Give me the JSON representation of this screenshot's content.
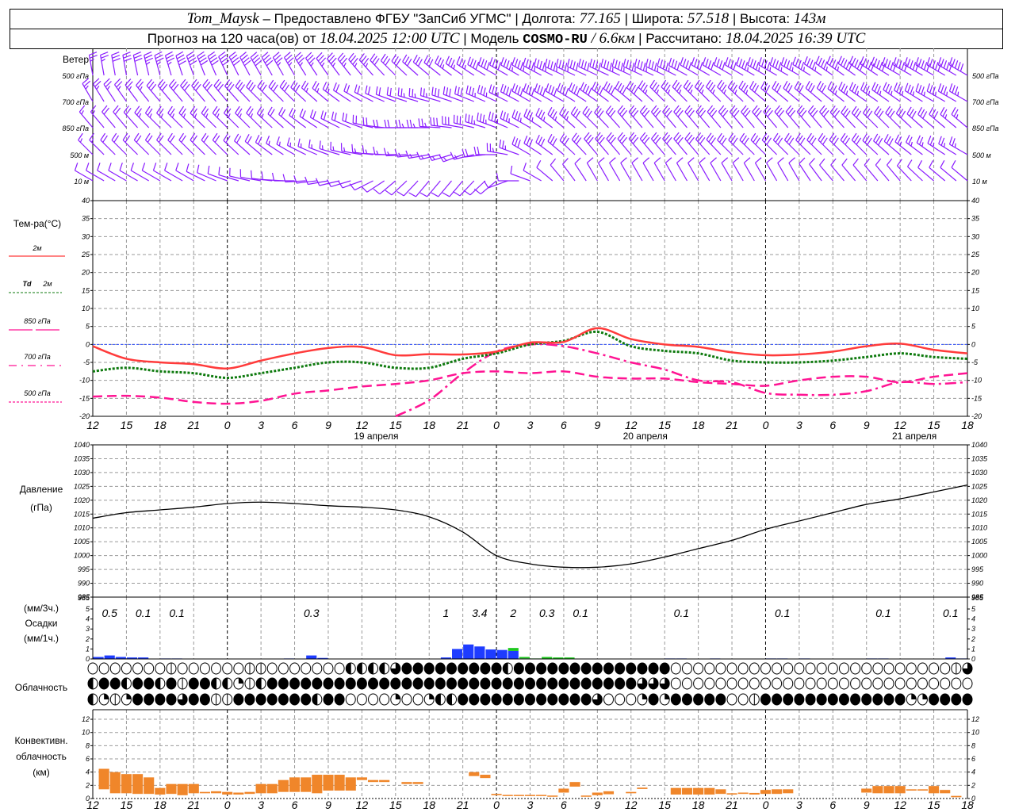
{
  "header": {
    "station": "Tom_Maysk",
    "provider": "– Предоставлено ФГБУ \"ЗапСиб УГМС\"",
    "lon_label": "| Долгота:",
    "lon": "77.165",
    "lat_label": "| Широта:",
    "lat": "57.518",
    "alt_label": "| Высота:",
    "alt": "143м",
    "forecast_label": "Прогноз на 120 часа(ов) от",
    "forecast_time": "18.04.2025 12:00 UTC",
    "model_label": "| Модель",
    "model": "COSMO-RU",
    "model_res": "/ 6.6км",
    "calc_label": "| Рассчитано:",
    "calc_time": "18.04.2025 16:39 UTC"
  },
  "colors": {
    "wind": "#8a1cff",
    "t2m": "#ff3b3b",
    "td2m": "#0e7a0e",
    "t850": "#ff1493",
    "t700": "#ff1493",
    "t500": "#ff1493",
    "rain": "#1e3cff",
    "snow": "#1ec81e",
    "convective": "#f0862a",
    "zero_line": "#3050ff"
  },
  "labels": {
    "wind": "Ветер",
    "wind_levels": [
      "500 гПа",
      "700 гПа",
      "850 гПа",
      "500 м",
      "10 м"
    ],
    "temp_title": "Тем-ра(°С)",
    "t2m": "2м",
    "td_a": "Td",
    "td_b": "2м",
    "t850": "850 гПа",
    "t700": "700 гПа",
    "t500": "500 гПа",
    "pressure_a": "Давление",
    "pressure_b": "(гПа)",
    "precip_a": "(мм/3ч.)",
    "precip_b": "Осадки",
    "precip_c": "(мм/1ч.)",
    "clouds": "Облачность",
    "conv_a": "Конвективн.",
    "conv_b": "облачность",
    "conv_c": "(км)",
    "dates": [
      "19 апреля",
      "20 апреля",
      "21 апреля"
    ]
  },
  "chart_data": {
    "hours_x_labels": [
      "12",
      "15",
      "18",
      "21",
      "0",
      "3",
      "6",
      "9",
      "12",
      "15",
      "18",
      "21",
      "0",
      "3",
      "6",
      "9",
      "12",
      "15",
      "18",
      "21",
      "0",
      "3",
      "6",
      "9",
      "12",
      "15",
      "18"
    ],
    "time_step_hours": 3,
    "temperature": {
      "ylim": [
        -20,
        40
      ],
      "ticks": [
        -20,
        -15,
        -10,
        -5,
        0,
        5,
        10,
        15,
        20,
        25,
        30,
        35,
        40
      ],
      "t2m": [
        -0.5,
        -4,
        -5,
        -5.5,
        -6.7,
        -4.5,
        -2.5,
        -1,
        -0.7,
        -3,
        -2.7,
        -2.8,
        -2,
        0.5,
        0.7,
        4.5,
        1.5,
        0,
        -0.7,
        -2.2,
        -3,
        -2.8,
        -2,
        -0.5,
        0.2,
        -1.5,
        -2.5
      ],
      "td2m": [
        -7.5,
        -6.5,
        -7.5,
        -8,
        -9.3,
        -8,
        -6.5,
        -5,
        -5,
        -6.5,
        -6.5,
        -4,
        -2.5,
        0,
        1,
        3.5,
        -0.5,
        -1.8,
        -2.5,
        -4.5,
        -5,
        -5,
        -4.5,
        -3.5,
        -2.5,
        -3.5,
        -4
      ],
      "t850": [
        -14.5,
        -14.3,
        -14.8,
        -16,
        -16.5,
        -15.7,
        -13.7,
        -12.8,
        -11.7,
        -11,
        -10,
        -8,
        -7.5,
        -8,
        -7.5,
        -9,
        -9.5,
        -9.5,
        -10.5,
        -11,
        -11.5,
        -10,
        -9,
        -9,
        -10.5,
        -9,
        -8
      ],
      "t700": [
        null,
        null,
        null,
        null,
        null,
        null,
        null,
        null,
        null,
        -20,
        -15.5,
        -8,
        -2,
        0,
        -0.5,
        -2.5,
        -5,
        -7,
        -10,
        -10.5,
        -13.5,
        -14,
        -14,
        -13,
        -10.5,
        -11,
        -10.5
      ]
    },
    "pressure": {
      "ylim": [
        985,
        1040
      ],
      "ticks": [
        985,
        990,
        995,
        1000,
        1005,
        1010,
        1015,
        1020,
        1025,
        1030,
        1035,
        1040
      ],
      "values": [
        1013.5,
        1015.5,
        1016.5,
        1017.5,
        1018.8,
        1019.3,
        1018.8,
        1018,
        1017.5,
        1016.5,
        1014,
        1008.5,
        1000,
        997,
        995.8,
        995.8,
        997,
        999.5,
        1002.5,
        1005.5,
        1009.5,
        1012.5,
        1015.5,
        1018.5,
        1020.5,
        1023,
        1025.5
      ]
    },
    "precip": {
      "ylim": [
        0,
        5
      ],
      "ticks": [
        0,
        1,
        2,
        3,
        4,
        5
      ],
      "totals_3h": [
        [
          "0.5",
          1.5
        ],
        [
          "0.1",
          4.5
        ],
        [
          "0.1",
          7.5
        ],
        [
          "0.3",
          19.5
        ],
        [
          "1",
          31.5
        ],
        [
          "3.4",
          34.5
        ],
        [
          "2",
          37.5
        ],
        [
          "0.3",
          40.5
        ],
        [
          "0.1",
          43.5
        ],
        [
          "0.1",
          52.5
        ],
        [
          "0.1",
          61.5
        ],
        [
          "0.1",
          70.5
        ],
        [
          "0.1",
          76.5
        ]
      ],
      "rain_1h": [
        [
          0,
          0.2
        ],
        [
          1,
          0.35
        ],
        [
          2,
          0.2
        ],
        [
          3,
          0.15
        ],
        [
          4,
          0.15
        ],
        [
          6,
          0.05
        ],
        [
          7,
          0.05
        ],
        [
          17,
          0.05
        ],
        [
          19,
          0.35
        ],
        [
          20,
          0.1
        ],
        [
          31,
          0.15
        ],
        [
          32,
          1.0
        ],
        [
          33,
          1.45
        ],
        [
          34,
          1.25
        ],
        [
          35,
          0.95
        ],
        [
          36,
          0.9
        ],
        [
          37,
          0.8
        ],
        [
          38,
          0.05
        ],
        [
          51,
          0.05
        ],
        [
          52,
          0.05
        ],
        [
          55,
          0.05
        ],
        [
          60,
          0.05
        ],
        [
          61,
          0.05
        ],
        [
          63,
          0.05
        ],
        [
          69,
          0.05
        ],
        [
          70,
          0.05
        ],
        [
          76,
          0.15
        ],
        [
          77,
          0.05
        ]
      ],
      "snow_1h": [
        [
          37,
          0.3
        ],
        [
          38,
          0.15
        ],
        [
          39,
          0.05
        ],
        [
          40,
          0.2
        ],
        [
          41,
          0.15
        ],
        [
          42,
          0.15
        ]
      ]
    },
    "clouds_legend": "O=clear, L=1/8, Q=1/4, H=1/2, T=3/4, F=overcast",
    "clouds_rows": [
      "OOOOOOOLOOOOOOLLOOOOOOOHHHHTFFFFFFFFFHFFFFFFFFFFFFFFOOOOOOOOOOOOOOOOOOOOOOOOOLT",
      "HFFHFFHFLFFHHQLHFFFFFFFFFFFFFFFFFFFFFFFFFFFFFFFFFTTTOOOOOOOOOOOOOOOOOOOOOOOOOOO",
      "HQLQFFFFTFFLLFFFFFFFHFFOOOOQOOQHHFFFFFFFFFFFFTOOOQFQFFFFFOOLFFFFFFFFFFFFFQQFFFF"
    ],
    "convective": {
      "ylim": [
        0,
        13
      ],
      "ticks": [
        0,
        2,
        4,
        6,
        8,
        10,
        12
      ],
      "bars_hour_bottom_top_km": [
        [
          1,
          1.4,
          4.5
        ],
        [
          2,
          0.8,
          4.0
        ],
        [
          3,
          0.8,
          3.7
        ],
        [
          4,
          0.7,
          3.7
        ],
        [
          5,
          0.7,
          3.2
        ],
        [
          6,
          0.6,
          1.6
        ],
        [
          7,
          0.7,
          2.2
        ],
        [
          8,
          0.5,
          2.2
        ],
        [
          9,
          0.8,
          2.2
        ],
        [
          10,
          0.8,
          1.0
        ],
        [
          11,
          0.8,
          1.1
        ],
        [
          12,
          0.6,
          1.0
        ],
        [
          13,
          0.6,
          0.9
        ],
        [
          14,
          0.7,
          1.0
        ],
        [
          15,
          0.8,
          2.2
        ],
        [
          16,
          0.8,
          2.2
        ],
        [
          17,
          1.0,
          2.8
        ],
        [
          18,
          1.0,
          3.2
        ],
        [
          19,
          1.0,
          3.2
        ],
        [
          20,
          0.8,
          3.6
        ],
        [
          21,
          1.2,
          3.6
        ],
        [
          22,
          1.2,
          3.6
        ],
        [
          23,
          1.2,
          3.2
        ],
        [
          24,
          2.8,
          3.2
        ],
        [
          25,
          2.5,
          2.8
        ],
        [
          26,
          2.5,
          2.8
        ],
        [
          28,
          2.2,
          2.5
        ],
        [
          29,
          2.2,
          2.5
        ],
        [
          34,
          3.4,
          4.0
        ],
        [
          35,
          3.1,
          3.6
        ],
        [
          36,
          0.5,
          0.7
        ],
        [
          37,
          0.4,
          0.55
        ],
        [
          38,
          0.4,
          0.55
        ],
        [
          39,
          0.4,
          0.55
        ],
        [
          40,
          0.4,
          0.55
        ],
        [
          41,
          0.3,
          0.45
        ],
        [
          42,
          0.9,
          1.5
        ],
        [
          43,
          1.8,
          2.5
        ],
        [
          44,
          0.3,
          0.45
        ],
        [
          45,
          0.5,
          0.9
        ],
        [
          46,
          0.65,
          1.1
        ],
        [
          48,
          0.8,
          1.0
        ],
        [
          49,
          1.45,
          1.65
        ],
        [
          52,
          0.6,
          1.6
        ],
        [
          53,
          0.6,
          1.6
        ],
        [
          54,
          0.6,
          1.6
        ],
        [
          55,
          0.6,
          1.6
        ],
        [
          56,
          0.7,
          1.4
        ],
        [
          57,
          0.6,
          0.8
        ],
        [
          58,
          0.7,
          0.9
        ],
        [
          59,
          0.6,
          0.85
        ],
        [
          60,
          0.7,
          1.3
        ],
        [
          61,
          0.7,
          1.4
        ],
        [
          62,
          0.8,
          1.4
        ],
        [
          69,
          0.9,
          1.5
        ],
        [
          70,
          0.8,
          1.9
        ],
        [
          71,
          0.8,
          1.9
        ],
        [
          72,
          0.8,
          1.9
        ],
        [
          73,
          1.2,
          1.4
        ],
        [
          74,
          1.2,
          1.4
        ],
        [
          75,
          0.8,
          1.9
        ],
        [
          76,
          0.8,
          1.3
        ],
        [
          77,
          0.2,
          0.4
        ]
      ]
    },
    "wind": {
      "units": "m/s",
      "levels": [
        {
          "dir": [
            350,
            350,
            345,
            340,
            335,
            330,
            330,
            325,
            320,
            315,
            310,
            305,
            300,
            300,
            295,
            295,
            295,
            295,
            300,
            300,
            300,
            300,
            305,
            305,
            300,
            300,
            300
          ],
          "speed": [
            12,
            15,
            18,
            20,
            20,
            20,
            18,
            18,
            18,
            15,
            15,
            18,
            20,
            22,
            22,
            20,
            22,
            22,
            20,
            20,
            22,
            22,
            22,
            25,
            25,
            25,
            25
          ]
        },
        {
          "dir": [
            330,
            325,
            320,
            320,
            320,
            315,
            315,
            310,
            300,
            290,
            285,
            290,
            295,
            300,
            300,
            305,
            310,
            315,
            315,
            315,
            310,
            310,
            310,
            305,
            305,
            300,
            300
          ],
          "speed": [
            12,
            12,
            14,
            15,
            15,
            15,
            15,
            12,
            10,
            10,
            12,
            15,
            18,
            20,
            20,
            20,
            20,
            18,
            18,
            18,
            16,
            16,
            16,
            18,
            18,
            18,
            18
          ]
        },
        {
          "dir": [
            320,
            320,
            315,
            315,
            315,
            315,
            310,
            300,
            290,
            270,
            270,
            280,
            290,
            300,
            310,
            315,
            320,
            320,
            320,
            320,
            320,
            320,
            320,
            315,
            315,
            310,
            310
          ],
          "speed": [
            8,
            10,
            12,
            12,
            12,
            12,
            10,
            10,
            10,
            10,
            12,
            15,
            18,
            18,
            18,
            15,
            15,
            15,
            15,
            15,
            15,
            15,
            15,
            15,
            15,
            15,
            12
          ]
        },
        {
          "dir": [
            315,
            315,
            315,
            315,
            315,
            310,
            300,
            290,
            280,
            270,
            260,
            250,
            270,
            300,
            310,
            320,
            320,
            320,
            320,
            315,
            315,
            315,
            315,
            315,
            310,
            305,
            300
          ],
          "speed": [
            8,
            10,
            10,
            10,
            10,
            10,
            8,
            8,
            8,
            8,
            8,
            8,
            10,
            14,
            15,
            15,
            15,
            15,
            15,
            15,
            15,
            15,
            15,
            14,
            14,
            12,
            12
          ]
        },
        {
          "dir": [
            300,
            300,
            300,
            300,
            290,
            280,
            270,
            260,
            250,
            230,
            220,
            220,
            230,
            290,
            320,
            330,
            330,
            330,
            330,
            330,
            330,
            330,
            320,
            320,
            320,
            310,
            310
          ],
          "speed": [
            4,
            4,
            4,
            5,
            5,
            5,
            4,
            4,
            4,
            5,
            6,
            6,
            6,
            6,
            6,
            6,
            5,
            5,
            5,
            5,
            5,
            5,
            5,
            5,
            5,
            5,
            5
          ]
        }
      ]
    }
  }
}
